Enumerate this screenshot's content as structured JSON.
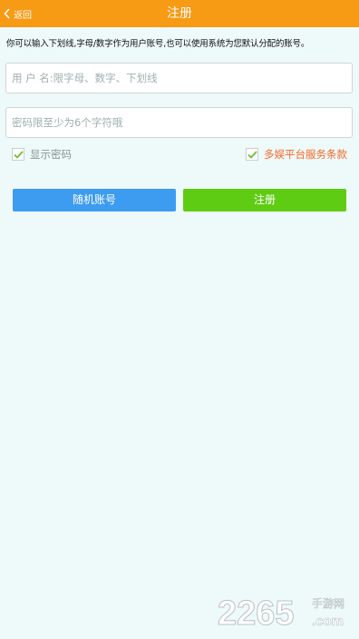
{
  "header": {
    "back_label": "返回",
    "title": "注册"
  },
  "hint": "你可以输入下划线,字母/数字作为用户账号,也可以使用系统为您默认分配的账号。",
  "form": {
    "username_placeholder": "用 户 名:限字母、数字、下划线",
    "password_placeholder": "密码限至少为6个字符哦",
    "show_password": {
      "label": "显示密码",
      "checked": true
    },
    "terms": {
      "label": "多娱平台服务条款",
      "checked": true
    },
    "random_button": "随机账号",
    "register_button": "注册"
  },
  "watermark": {
    "brand": "2265",
    "sub1": "手游网",
    "sub2": ".com"
  },
  "colors": {
    "header_bg": "#f79a14",
    "background": "#eef9f9",
    "random_button": "#3d9cf0",
    "register_button": "#5fcc14",
    "terms_text": "#f26a2a",
    "check_mark": "#6cbf2e"
  }
}
